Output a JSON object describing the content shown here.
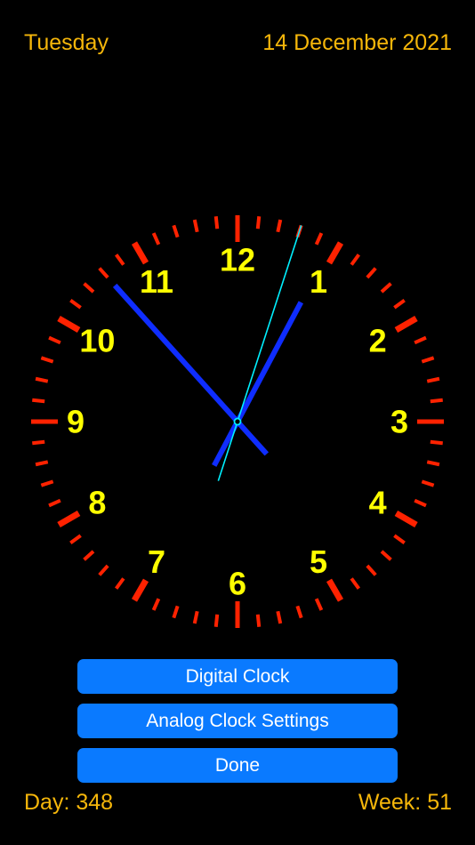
{
  "header": {
    "weekday": "Tuesday",
    "date": "14 December 2021"
  },
  "clock": {
    "numerals": [
      "12",
      "1",
      "2",
      "3",
      "4",
      "5",
      "6",
      "7",
      "8",
      "9",
      "10",
      "11"
    ],
    "time": {
      "hour": 12,
      "minute": 53,
      "second": 2
    },
    "colors": {
      "ticks": "#ff2200",
      "numerals": "#ffff00",
      "hour_minute_hands": "#0f2dff",
      "second_hand": "#00f0ff",
      "background": "#000000"
    }
  },
  "buttons": {
    "digital_label": "Digital Clock",
    "settings_label": "Analog Clock Settings",
    "done_label": "Done",
    "color": "#0a7aff"
  },
  "footer": {
    "day_label": "Day: 348",
    "week_label": "Week: 51"
  }
}
